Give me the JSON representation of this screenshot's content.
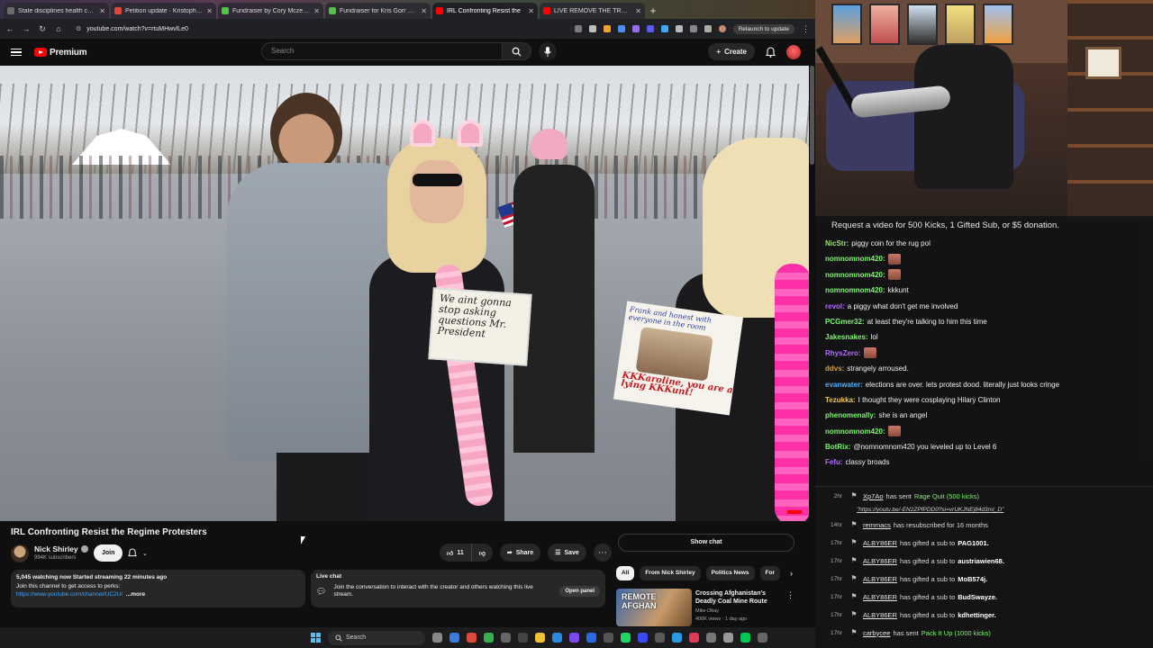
{
  "browser": {
    "tabs": [
      {
        "title": "State disciplines health care pr",
        "color": "#6b6b6b",
        "active": false
      },
      {
        "title": "Petition update · Kristopher's",
        "color": "#e0453a",
        "active": false
      },
      {
        "title": "Fundraiser by Cory Mczenna :",
        "color": "#52c24b",
        "active": false
      },
      {
        "title": "Fundraiser for Kris Gorr by Kel",
        "color": "#52c24b",
        "active": false
      },
      {
        "title": "IRL Confronting Resist the",
        "color": "#ff0000",
        "active": true
      },
      {
        "title": "LIVE REMOVE THE TRUMP REG",
        "color": "#ff0000",
        "active": false
      }
    ],
    "url": "youtube.com/watch?v=rtuMHwvlLe0",
    "relaunch_label": "Relaunch to update"
  },
  "youtube": {
    "logo_text": "Premium",
    "search_placeholder": "Search",
    "create_label": "Create"
  },
  "video": {
    "sign_left_text": "We aint gonna stop asking questions Mr. President",
    "sign_right_text": "Frank and honest with everyone in the room",
    "sign_right_kkk": "KKKaroline, you are a lying KKKunt!"
  },
  "meta": {
    "title": "IRL Confronting Resist the Regime Protesters",
    "channel_name": "Nick Shirley",
    "subscribers": "994K subscribers",
    "join_label": "Join",
    "like_count": "11",
    "share_label": "Share",
    "save_label": "Save",
    "watching": "5,045 watching now  Started streaming 22 minutes ago",
    "perks_line": "Join this channel to get access to perks:",
    "channel_link": "https://www.youtube.com/channel/UC2Ui",
    "more_label": "...more",
    "live_chat_heading": "Live chat",
    "live_chat_text": "Join the conversation to interact with the creator and others watching this live stream.",
    "open_panel_label": "Open panel",
    "show_chat_label": "Show chat"
  },
  "chips": [
    "All",
    "From Nick Shirley",
    "Politics News",
    "For"
  ],
  "recommended": {
    "thumb_text": "REMOTE AFGHAN",
    "title": "Crossing Afghanistan's Deadly Coal Mine Route",
    "channel": "Mike Okay",
    "views": "406K views · 1 day ago"
  },
  "taskbar": {
    "search_label": "Search"
  },
  "chat": {
    "pinned": "Request a video for 500 Kicks, 1 Gifted Sub, or $5 donation.",
    "messages": [
      {
        "user": "NicStr:",
        "color": "#9be06a",
        "text": "piggy coin for the rug pol",
        "emote": false
      },
      {
        "user": "nomnomnom420:",
        "color": "#7ef56d",
        "text": "",
        "emote": true
      },
      {
        "user": "nomnomnom420:",
        "color": "#7ef56d",
        "text": "",
        "emote": true
      },
      {
        "user": "nomnomnom420:",
        "color": "#7ef56d",
        "text": "kkkunt",
        "emote": false
      },
      {
        "user": "revol:",
        "color": "#b36bff",
        "text": "a piggy what    don't get me involved",
        "emote": false
      },
      {
        "user": "PCGmer32:",
        "color": "#7ef56d",
        "text": "at least they're talking to him this time",
        "emote": false
      },
      {
        "user": "Jakesnakes:",
        "color": "#7ef56d",
        "text": "lol",
        "emote": false
      },
      {
        "user": "RhysZero:",
        "color": "#b36bff",
        "text": "",
        "emote": true
      },
      {
        "user": "ddvs:",
        "color": "#d8a13a",
        "text": "strangely arroused.",
        "emote": false
      },
      {
        "user": "evanwater:",
        "color": "#4ab0ff",
        "text": "elections are over. lets protest dood. literally just looks cringe",
        "emote": false
      },
      {
        "user": "Tezukka:",
        "color": "#f0c93a",
        "text": "I thought they were cosplaying Hilary Clinton",
        "emote": false
      },
      {
        "user": "phenomenally:",
        "color": "#7ef56d",
        "text": "she is an angel",
        "emote": false
      },
      {
        "user": "nomnomnom420:",
        "color": "#7ef56d",
        "text": "",
        "emote": true
      },
      {
        "user": "BotRix:",
        "color": "#7ef56d",
        "text": "@nomnomnom420 you leveled up to Level 6",
        "emote": false
      },
      {
        "user": "Fefu:",
        "color": "#b36bff",
        "text": "classy broads",
        "emote": false
      }
    ]
  },
  "events": [
    {
      "time": "2hr",
      "name": "Xp7Ao",
      "action": "has sent",
      "gift": "Rage Quit (500 kicks)",
      "target": ""
    },
    {
      "time": "14hr",
      "name": "remmacs",
      "action": "has resubscribed for 16 months",
      "gift": "",
      "target": ""
    },
    {
      "time": "17hr",
      "name": "ALBY86ER",
      "action": "has gifted a sub to",
      "gift": "",
      "target": "PAG1001."
    },
    {
      "time": "17hr",
      "name": "ALBY86ER",
      "action": "has gifted a sub to",
      "gift": "",
      "target": "austriawien68."
    },
    {
      "time": "17hr",
      "name": "ALBY86ER",
      "action": "has gifted a sub to",
      "gift": "",
      "target": "MoB574j."
    },
    {
      "time": "17hr",
      "name": "ALBY86ER",
      "action": "has gifted a sub to",
      "gift": "",
      "target": "BudSwayze."
    },
    {
      "time": "17hr",
      "name": "ALBY86ER",
      "action": "has gifted a sub to",
      "gift": "",
      "target": "kdhettinger."
    },
    {
      "time": "17hr",
      "name": "carbycee",
      "action": "has sent",
      "gift": "Pack It Up (1000 kicks)",
      "target": ""
    }
  ],
  "event_link": "\"https://youtu.be/-EN2ZPfPDD0?si=vrUKJNEj84d3mI_D\""
}
